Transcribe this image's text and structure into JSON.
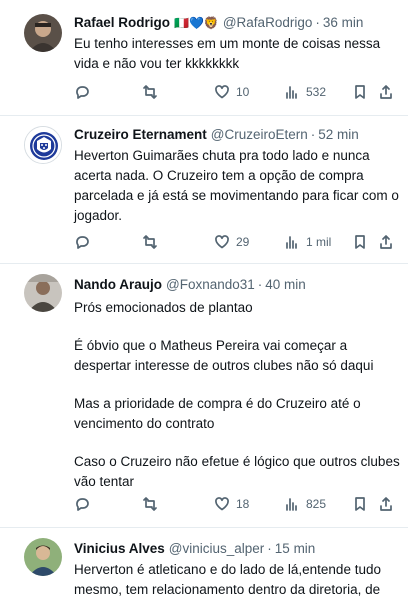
{
  "tweets": [
    {
      "name": "Rafael Rodrigo",
      "flags": "🇮🇹💙🦁",
      "handle": "@RafaRodrigo",
      "time": "36 min",
      "text": [
        "Eu tenho interesses em um monte de coisas nessa vida e não vou ter kkkkkkkk"
      ],
      "replies": "",
      "retweets": "",
      "likes": "10",
      "views": "532"
    },
    {
      "name": "Cruzeiro Eternament",
      "handle": "@CruzeiroEtern",
      "time": "52 min",
      "text": [
        "Heverton Guimarães chuta pra todo lado e nunca acerta nada. O Cruzeiro tem a opção de compra parcelada e já está se movimentando para ficar com o jogador."
      ],
      "replies": "",
      "retweets": "",
      "likes": "29",
      "views": "1 mil"
    },
    {
      "name": "Nando Araujo",
      "handle": "@Foxnando31",
      "time": "40 min",
      "text": [
        "Prós emocionados de plantao",
        "É óbvio que o Matheus Pereira vai começar a despertar interesse de outros clubes não só daqui",
        "Mas a prioridade de compra é do Cruzeiro até o vencimento do contrato",
        "Caso o Cruzeiro não efetue é lógico que outros clubes vão tentar"
      ],
      "replies": "",
      "retweets": "",
      "likes": "18",
      "views": "825"
    },
    {
      "name": "Vinicius Alves",
      "handle": "@vinicius_alper",
      "time": "15 min",
      "text": [
        "Herverton é atleticano e do lado de lá,entende tudo mesmo, tem relacionamento dentro da diretoria, de cruzeiro tem mais informações de"
      ]
    }
  ],
  "colors": {
    "text": "#0f1419",
    "muted": "#536471",
    "divider": "#e6ecf0",
    "cruzeiro_blue": "#1e3a9a"
  }
}
